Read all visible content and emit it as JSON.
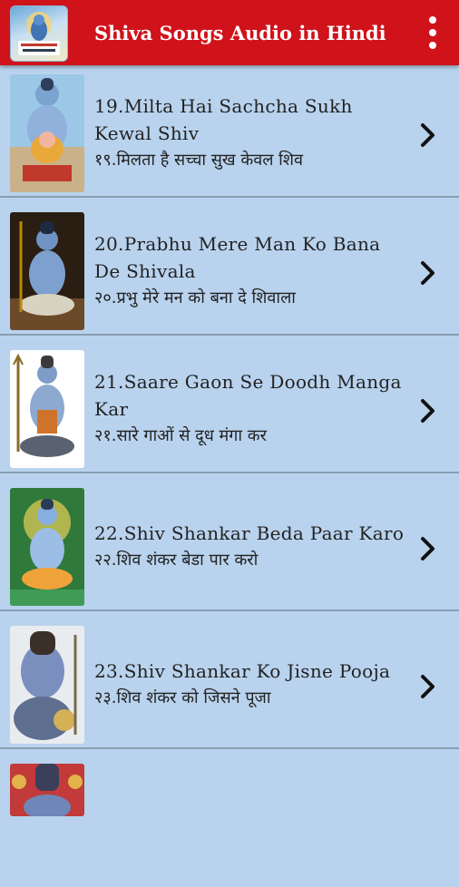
{
  "app": {
    "title": "Shiva Songs Audio in Hindi",
    "bar_color": "#d0121b",
    "background": "#b9d3ee"
  },
  "icons": {
    "menu": "more-vert-icon",
    "row_action": "chevron-right-icon"
  },
  "songs": [
    {
      "title": "19.Milta Hai Sachcha Sukh Kewal Shiv",
      "hindi": "१९.मिलता है सच्चा सुख केवल शिव"
    },
    {
      "title": "20.Prabhu Mere Man Ko Bana De Shivala",
      "hindi": "२०.प्रभु मेरे मन को बना दे शिवाला"
    },
    {
      "title": "21.Saare Gaon Se Doodh Manga Kar",
      "hindi": "२१.सारे गाओं से दूध मंगा कर"
    },
    {
      "title": "22.Shiv Shankar Beda Paar Karo",
      "hindi": "२२.शिव शंकर बेडा पार करो"
    },
    {
      "title": "23.Shiv Shankar Ko Jisne Pooja",
      "hindi": "२३.शिव शंकर को जिसने पूजा"
    }
  ]
}
